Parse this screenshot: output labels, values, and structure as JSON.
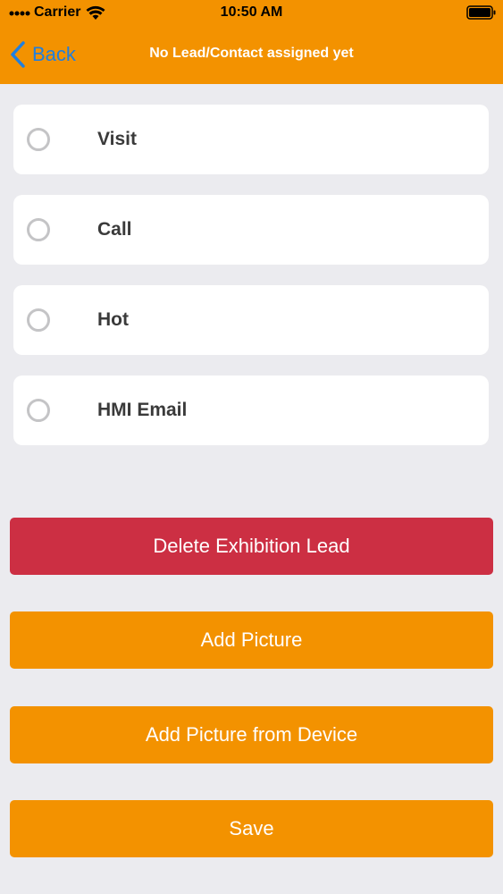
{
  "status_bar": {
    "carrier": "Carrier",
    "time": "10:50 AM"
  },
  "nav": {
    "back_label": "Back",
    "title": "No Lead/Contact assigned yet"
  },
  "options": [
    {
      "label": "Visit",
      "selected": false
    },
    {
      "label": "Call",
      "selected": false
    },
    {
      "label": "Hot",
      "selected": false
    },
    {
      "label": "HMI Email",
      "selected": false
    }
  ],
  "buttons": {
    "delete_label": "Delete Exhibition Lead",
    "add_picture_label": "Add Picture",
    "add_picture_device_label": "Add Picture from Device",
    "save_label": "Save"
  },
  "colors": {
    "accent": "#f39200",
    "danger": "#cc2f43",
    "link": "#1f7fe0",
    "background": "#ebebef"
  }
}
